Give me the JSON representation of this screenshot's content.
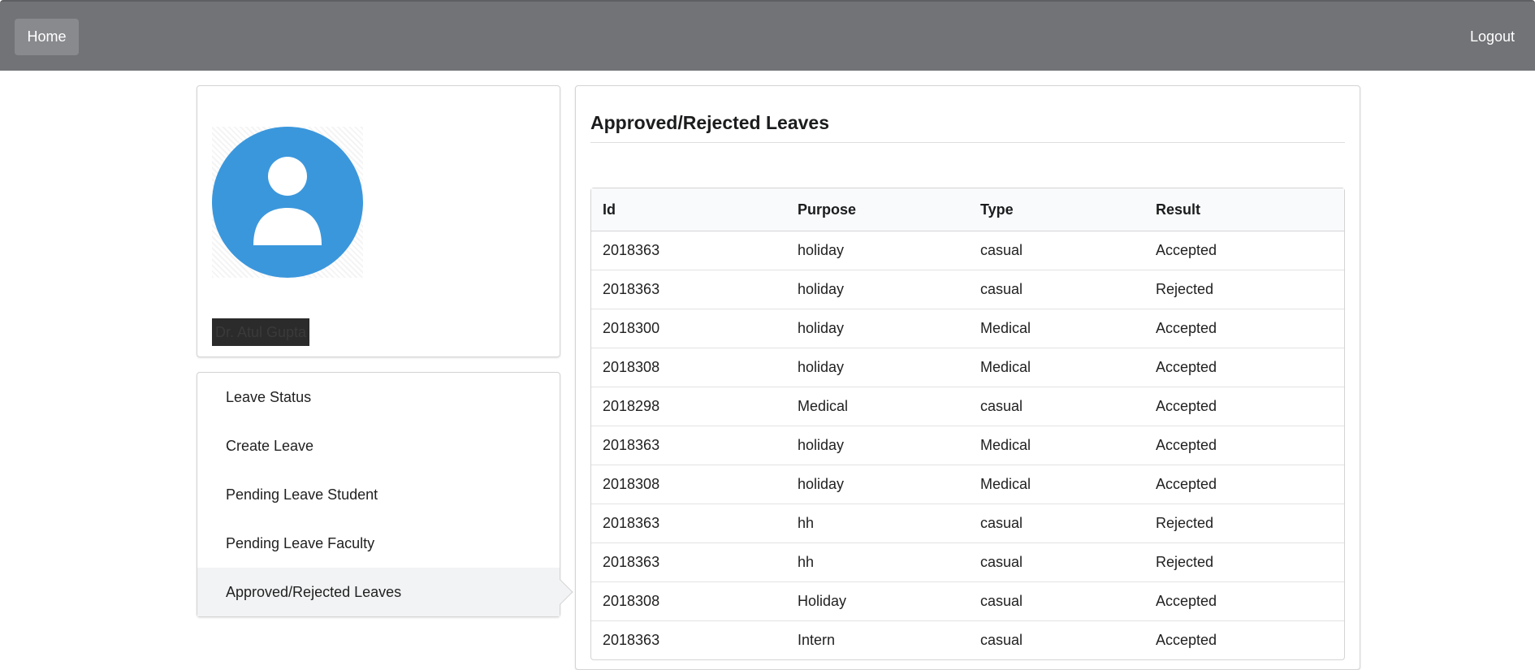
{
  "nav": {
    "home_label": "Home",
    "logout_label": "Logout"
  },
  "profile": {
    "name": "Dr. Atul Gupta"
  },
  "menu": {
    "items": [
      {
        "label": "Leave Status"
      },
      {
        "label": "Create Leave"
      },
      {
        "label": "Pending Leave Student"
      },
      {
        "label": "Pending Leave Faculty"
      },
      {
        "label": "Approved/Rejected Leaves"
      }
    ],
    "active_index": 4
  },
  "main": {
    "title": "Approved/Rejected Leaves",
    "table": {
      "columns": [
        "Id",
        "Purpose",
        "Type",
        "Result"
      ],
      "rows": [
        [
          "2018363",
          "holiday",
          "casual",
          "Accepted"
        ],
        [
          "2018363",
          "holiday",
          "casual",
          "Rejected"
        ],
        [
          "2018300",
          "holiday",
          "Medical",
          "Accepted"
        ],
        [
          "2018308",
          "holiday",
          "Medical",
          "Accepted"
        ],
        [
          "2018298",
          "Medical",
          "casual",
          "Accepted"
        ],
        [
          "2018363",
          "holiday",
          "Medical",
          "Accepted"
        ],
        [
          "2018308",
          "holiday",
          "Medical",
          "Accepted"
        ],
        [
          "2018363",
          "hh",
          "casual",
          "Rejected"
        ],
        [
          "2018363",
          "hh",
          "casual",
          "Rejected"
        ],
        [
          "2018308",
          "Holiday",
          "casual",
          "Accepted"
        ],
        [
          "2018363",
          "Intern",
          "casual",
          "Accepted"
        ]
      ]
    }
  },
  "colors": {
    "navbar": "#727377",
    "avatar": "#3b97dc",
    "active_menu": "#f2f3f4"
  }
}
